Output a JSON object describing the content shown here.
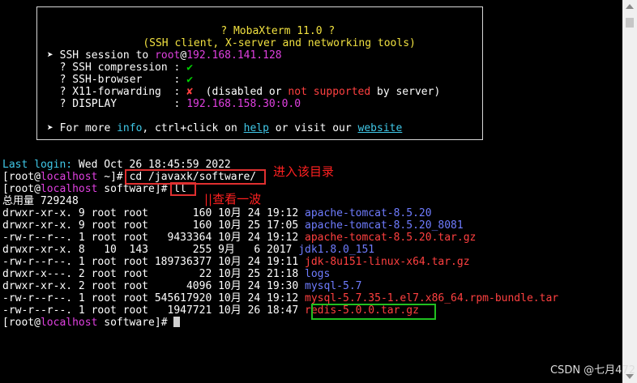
{
  "banner": {
    "title": "? MobaXterm 11.0 ?",
    "subtitle": "(SSH client, X-server and networking tools)",
    "ssh_session_prefix": "➤ SSH session to ",
    "ssh_user": "root",
    "ssh_at": "@",
    "ssh_host": "192.168.141.128",
    "compression_label": "  ? SSH compression : ",
    "compression_value": "✔",
    "browser_label": "  ? SSH-browser     : ",
    "browser_value": "✔",
    "x11_label": "  ? X11-forwarding  : ",
    "x11_value": "✘",
    "x11_note_open": "  (disabled or ",
    "x11_note_not": "not supported",
    "x11_note_close": " by server)",
    "display_label": "  ? DISPLAY         : ",
    "display_value": "192.168.158.30:0.0",
    "more_prefix": "➤ For more ",
    "more_info": "info",
    "more_mid": ", ctrl+click on ",
    "more_help": "help",
    "more_or": " or visit our ",
    "more_website": "website"
  },
  "terminal": {
    "last_login_label": "Last login:",
    "last_login_value": " Wed Oct 26 18:45:59 2022",
    "prompt1_a": "[root@",
    "prompt1_host": "localhost",
    "prompt1_b": " ~]# ",
    "cmd1": "cd /javaxk/software/",
    "prompt2_a": "[root@",
    "prompt2_host": "localhost",
    "prompt2_b": " software]# ",
    "cmd2": "ll",
    "total": "总用量 729248",
    "listing": [
      {
        "meta": "drwxr-xr-x. 9 root root       160 10月 24 19:12 ",
        "name": "apache-tomcat-8.5.20"
      },
      {
        "meta": "drwxr-xr-x. 9 root root       160 10月 25 17:05 ",
        "name": "apache-tomcat-8.5.20_8081"
      },
      {
        "meta": "-rw-r--r--. 1 root root   9433364 10月 24 19:12 ",
        "name": "apache-tomcat-8.5.20.tar.gz"
      },
      {
        "meta": "drwxr-xr-x. 8   10  143       255 9月   6 2017 ",
        "name": "jdk1.8.0_151"
      },
      {
        "meta": "-rw-r--r--. 1 root root 189736377 10月 24 19:11 ",
        "name": "jdk-8u151-linux-x64.tar.gz"
      },
      {
        "meta": "drwxr-x---. 2 root root        22 10月 25 21:18 ",
        "name": "logs"
      },
      {
        "meta": "drwxr-xr-x. 2 root root      4096 10月 24 19:30 ",
        "name": "mysql-5.7"
      },
      {
        "meta": "-rw-r--r--. 1 root root 545617920 10月 24 19:12 ",
        "name": "mysql-5.7.35-1.el7.x86_64.rpm-bundle.tar"
      },
      {
        "meta": "-rw-r--r--. 1 root root   1947721 10月 26 18:47 ",
        "name": "redis-5.0.0.tar.gz"
      }
    ],
    "prompt3_a": "[root@",
    "prompt3_host": "localhost",
    "prompt3_b": " software]# "
  },
  "annotations": {
    "note1": "进入该目录",
    "note2": "||查看一波"
  },
  "watermark": "CSDN @七月472"
}
